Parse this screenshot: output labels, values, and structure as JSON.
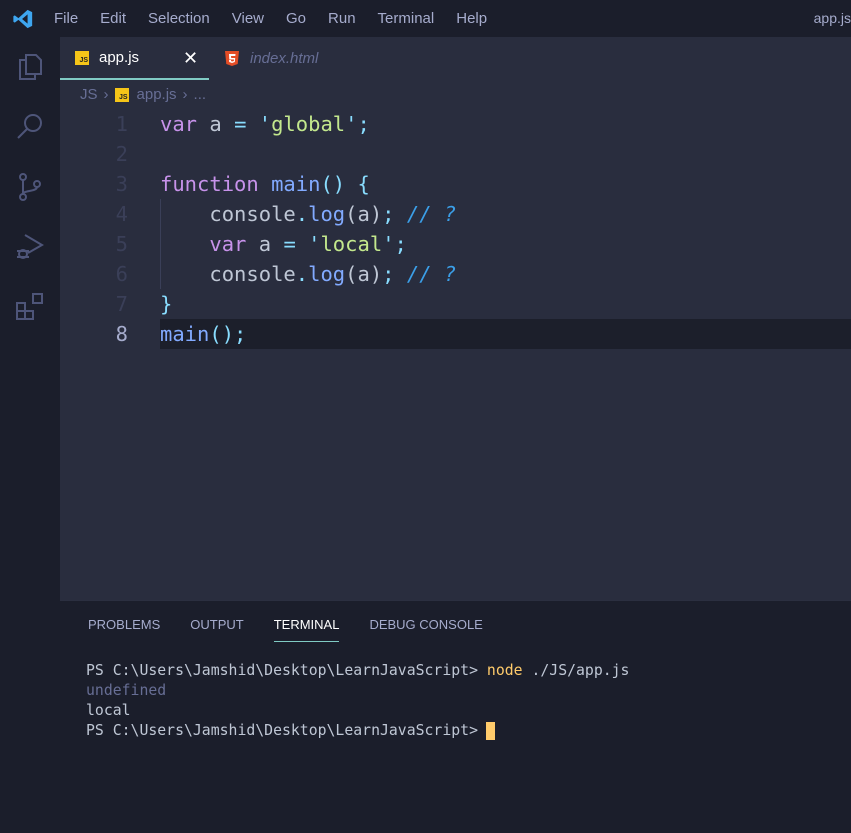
{
  "titlebar": {
    "menu": [
      "File",
      "Edit",
      "Selection",
      "View",
      "Go",
      "Run",
      "Terminal",
      "Help"
    ],
    "window_title": "app.js"
  },
  "activity": [
    "explorer-icon",
    "search-icon",
    "source-control-icon",
    "run-debug-icon",
    "extensions-icon"
  ],
  "tabs": [
    {
      "label": "app.js",
      "icon": "JS",
      "active": true
    },
    {
      "label": "index.html",
      "icon": "html5-icon",
      "active": false
    }
  ],
  "breadcrumb": {
    "folder": "JS",
    "file": "app.js",
    "more": "..."
  },
  "editor": {
    "line_numbers": [
      "1",
      "2",
      "3",
      "4",
      "5",
      "6",
      "7",
      "8"
    ],
    "current_line": 8,
    "lines": [
      [
        {
          "t": "kw",
          "v": "var"
        },
        {
          "t": "pl",
          "v": " a "
        },
        {
          "t": "op",
          "v": "="
        },
        {
          "t": "pl",
          "v": " "
        },
        {
          "t": "op",
          "v": "'"
        },
        {
          "t": "str",
          "v": "global"
        },
        {
          "t": "op",
          "v": "'"
        },
        {
          "t": "op",
          "v": ";"
        }
      ],
      [],
      [
        {
          "t": "kw",
          "v": "function"
        },
        {
          "t": "pl",
          "v": " "
        },
        {
          "t": "fn",
          "v": "main"
        },
        {
          "t": "op",
          "v": "()"
        },
        {
          "t": "pl",
          "v": " "
        },
        {
          "t": "op",
          "v": "{"
        }
      ],
      [
        {
          "t": "pl",
          "v": "    console"
        },
        {
          "t": "op",
          "v": "."
        },
        {
          "t": "fn",
          "v": "log"
        },
        {
          "t": "pl",
          "v": "(a)"
        },
        {
          "t": "op",
          "v": ";"
        },
        {
          "t": "pl",
          "v": " "
        },
        {
          "t": "cm",
          "v": "// ?"
        }
      ],
      [
        {
          "t": "kw",
          "v": "    var"
        },
        {
          "t": "pl",
          "v": " a "
        },
        {
          "t": "op",
          "v": "="
        },
        {
          "t": "pl",
          "v": " "
        },
        {
          "t": "op",
          "v": "'"
        },
        {
          "t": "str",
          "v": "local"
        },
        {
          "t": "op",
          "v": "'"
        },
        {
          "t": "op",
          "v": ";"
        }
      ],
      [
        {
          "t": "pl",
          "v": "    console"
        },
        {
          "t": "op",
          "v": "."
        },
        {
          "t": "fn",
          "v": "log"
        },
        {
          "t": "pl",
          "v": "(a)"
        },
        {
          "t": "op",
          "v": ";"
        },
        {
          "t": "pl",
          "v": " "
        },
        {
          "t": "cm",
          "v": "// ?"
        }
      ],
      [
        {
          "t": "op",
          "v": "}"
        }
      ],
      [
        {
          "t": "fn",
          "v": "main"
        },
        {
          "t": "op",
          "v": "();"
        }
      ]
    ]
  },
  "panel": {
    "tabs": [
      "PROBLEMS",
      "OUTPUT",
      "TERMINAL",
      "DEBUG CONSOLE"
    ],
    "active_tab": "TERMINAL",
    "terminal": {
      "prompt": "PS C:\\Users\\Jamshid\\Desktop\\LearnJavaScript>",
      "command_name": "node",
      "command_args": "./JS/app.js",
      "output": [
        "undefined",
        "local"
      ]
    }
  }
}
